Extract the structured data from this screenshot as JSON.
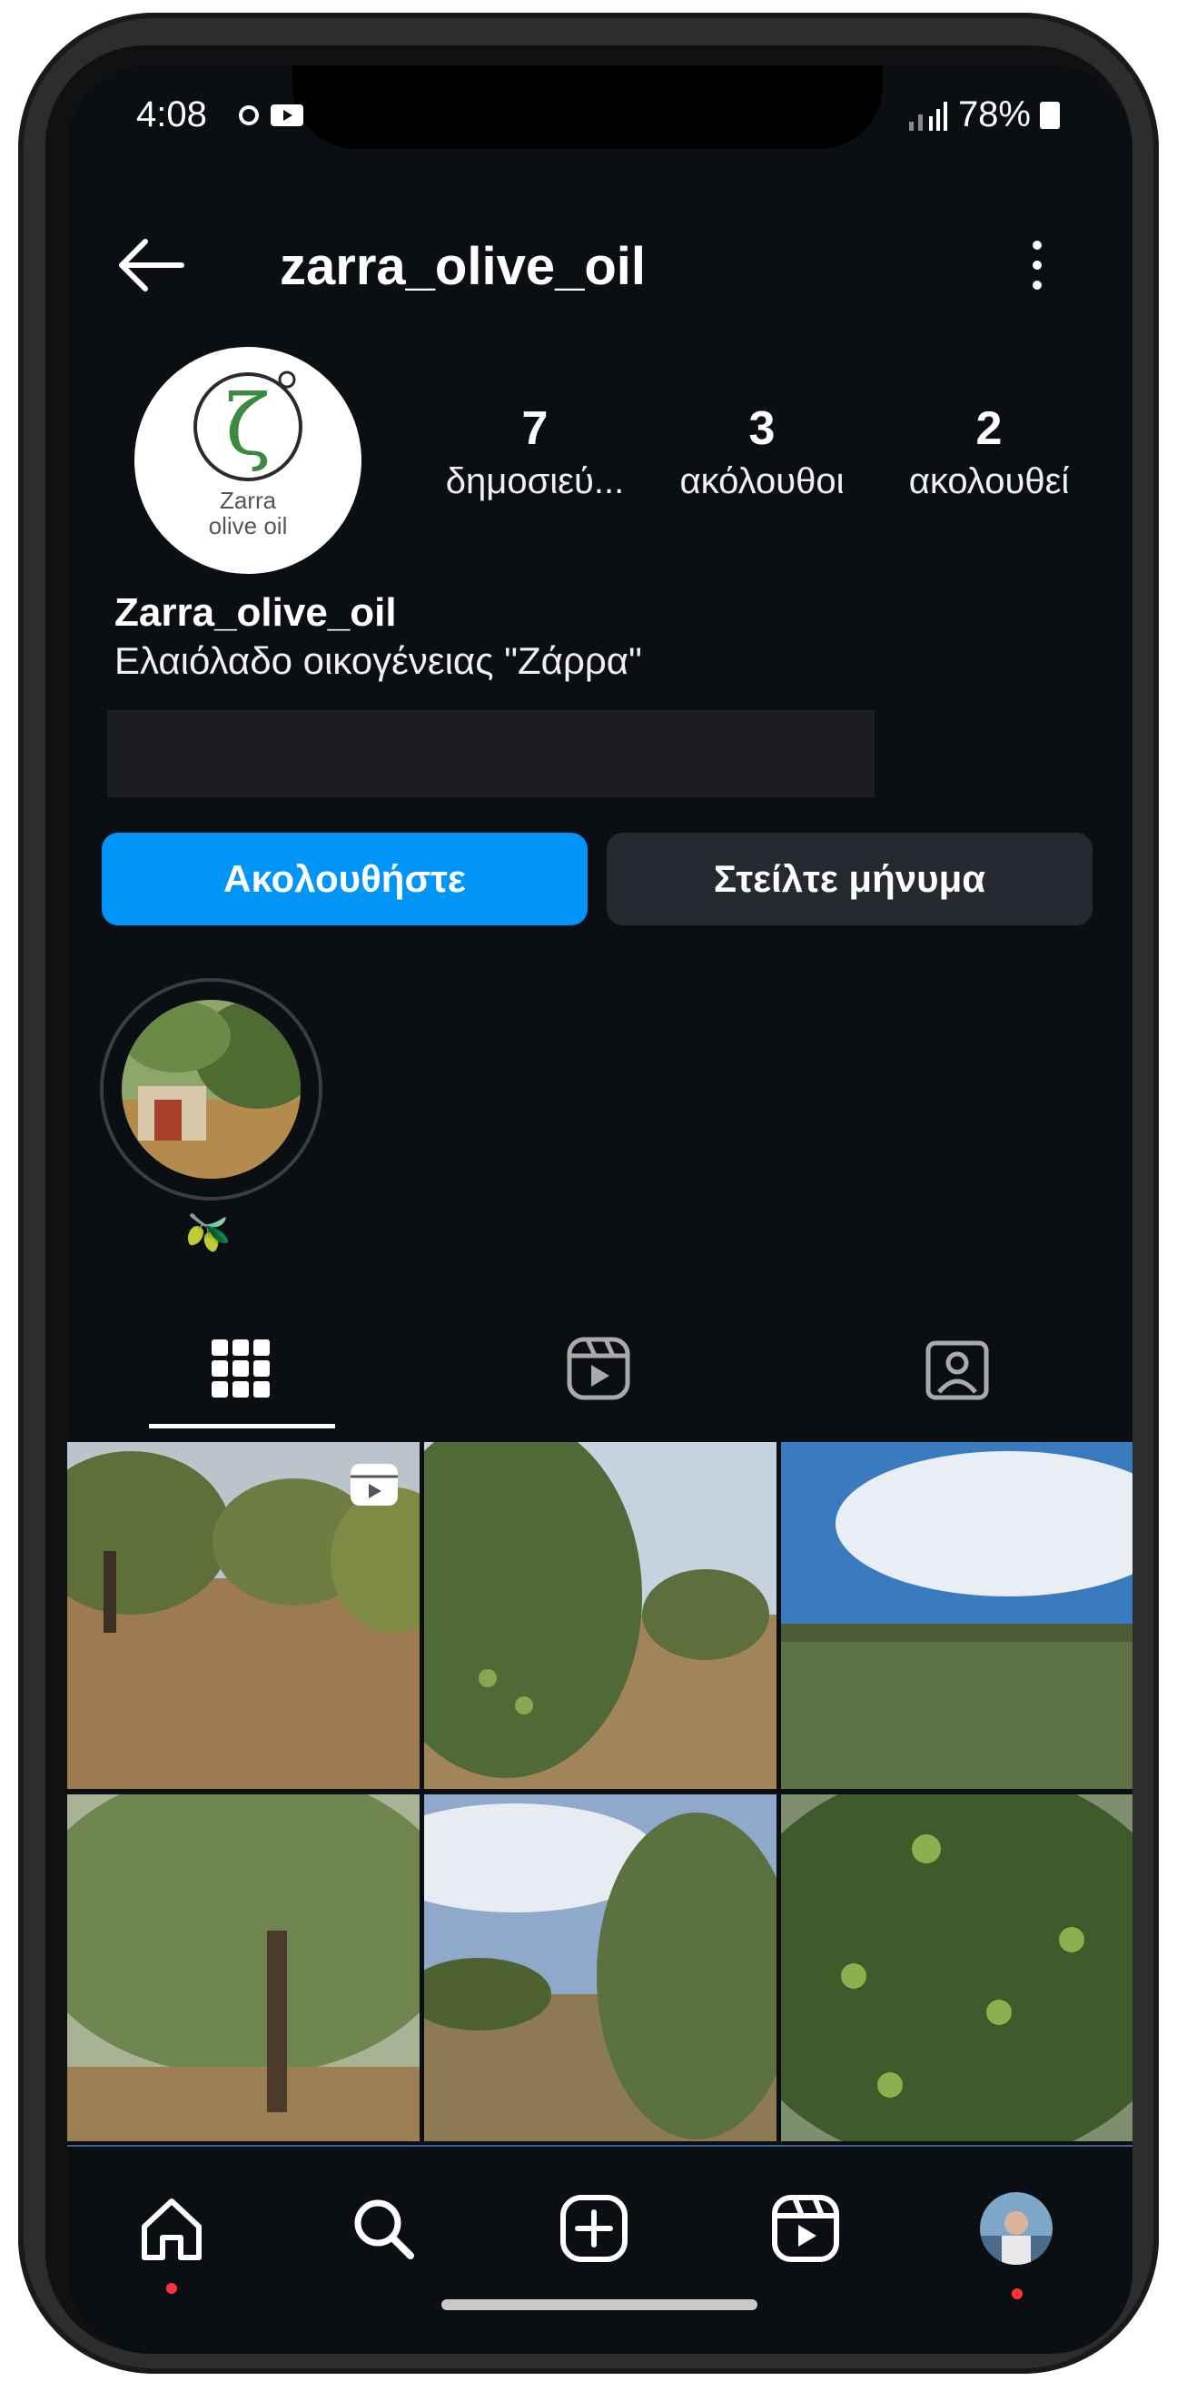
{
  "status": {
    "time": "4:08",
    "battery": "78%",
    "left_icons": "sync-icon, youtube-icon",
    "right_icons": "wifi-icon, signal-icon, battery-icon"
  },
  "header": {
    "username": "zarra_olive_oil",
    "back_icon": "arrow-left-icon",
    "more_icon": "vertical-dots-icon"
  },
  "profile": {
    "avatar_text_line1": "Zarra",
    "avatar_text_line2": "olive oil",
    "avatar_symbol": "ζ",
    "stats": [
      {
        "num": "7",
        "label": "δημοσιεύ..."
      },
      {
        "num": "3",
        "label": "ακόλουθοι"
      },
      {
        "num": "2",
        "label": "ακολουθεί"
      }
    ],
    "display_name": "Zarra_olive_oil",
    "bio": "Ελαιόλαδο οικογένειας \"Ζάρρα\""
  },
  "actions": {
    "follow_label": "Ακολουθήστε",
    "message_label": "Στείλτε μήνυμα"
  },
  "highlight": {
    "label": "🫒"
  },
  "tabs": [
    "grid-icon",
    "reels-icon",
    "tagged-icon"
  ],
  "nav": [
    "home-icon",
    "search-icon",
    "create-icon",
    "reels-icon",
    "profile-avatar"
  ],
  "colors": {
    "background": "#0b0e13",
    "primary": "#0095f6",
    "secondary_button": "#262a30"
  }
}
